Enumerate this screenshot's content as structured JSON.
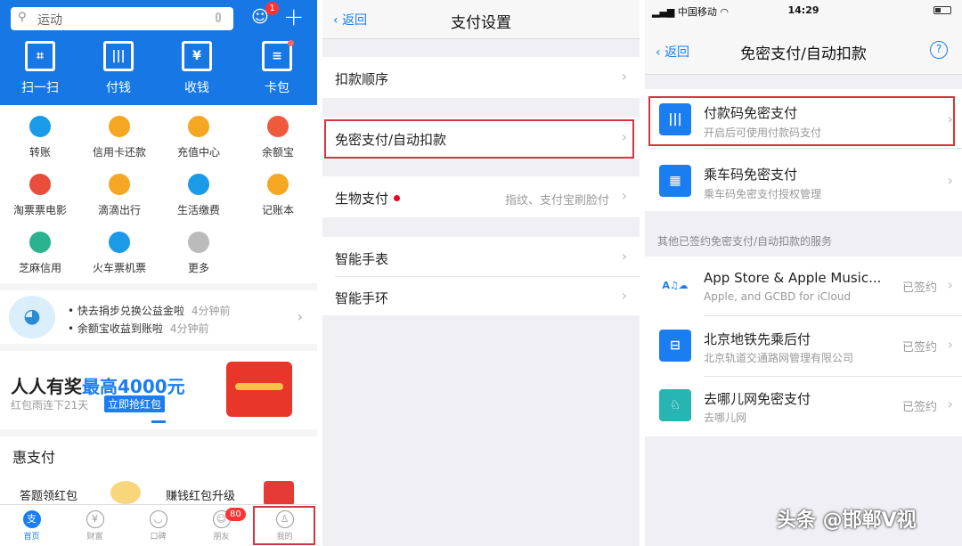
{
  "panel1": {
    "search": {
      "placeholder": "运动"
    },
    "contact_badge": "1",
    "big_actions": [
      {
        "label": "扫一扫",
        "icon": "scan-icon"
      },
      {
        "label": "付钱",
        "icon": "barcode-icon"
      },
      {
        "label": "收钱",
        "icon": "receive-money-icon"
      },
      {
        "label": "卡包",
        "icon": "card-wallet-icon"
      }
    ],
    "grid": [
      {
        "label": "转账",
        "icon": "transfer-icon",
        "color": "#1b9ae8"
      },
      {
        "label": "信用卡还款",
        "icon": "credit-card-icon",
        "color": "#f5a623"
      },
      {
        "label": "充值中心",
        "icon": "phone-icon",
        "color": "#f5a623"
      },
      {
        "label": "余额宝",
        "icon": "money-bag-icon",
        "color": "#f05a3c"
      },
      {
        "label": "淘票票电影",
        "icon": "movie-icon",
        "color": "#e94e3b"
      },
      {
        "label": "滴滴出行",
        "icon": "didi-icon",
        "color": "#f5a623"
      },
      {
        "label": "生活缴费",
        "icon": "bolt-icon",
        "color": "#1b9ae8"
      },
      {
        "label": "记账本",
        "icon": "ledger-icon",
        "color": "#f5a623"
      },
      {
        "label": "芝麻信用",
        "icon": "sesame-icon",
        "color": "#2bb28f"
      },
      {
        "label": "火车票机票",
        "icon": "train-icon",
        "color": "#1b9ae8"
      },
      {
        "label": "更多",
        "icon": "more-grid-icon",
        "color": "#bbbbbb"
      }
    ],
    "news": [
      {
        "text": "快去捐步兑换公益金啦",
        "time": "4分钟前"
      },
      {
        "text": "余额宝收益到账啦",
        "time": "4分钟前"
      }
    ],
    "promo": {
      "title_a": "人人有奖",
      "title_b": "最高4000元",
      "sub": "红包雨连下21天",
      "button": "立即抢红包"
    },
    "hui": {
      "heading": "惠支付",
      "item_a": "答题领红包",
      "item_b": "赚钱红包升级"
    },
    "tabs": [
      {
        "label": "首页",
        "glyph": "支"
      },
      {
        "label": "财富",
        "glyph": "¥"
      },
      {
        "label": "口碑",
        "glyph": "◡"
      },
      {
        "label": "朋友",
        "glyph": "☺"
      },
      {
        "label": "我的",
        "glyph": "♙"
      }
    ],
    "friends_badge": "80"
  },
  "panel2": {
    "back": "返回",
    "title": "支付设置",
    "rows": [
      {
        "label": "扣款顺序",
        "value": ""
      },
      {
        "label": "免密支付/自动扣款",
        "value": ""
      },
      {
        "label": "生物支付",
        "value": "指纹、支付宝刷脸付"
      },
      {
        "label": "智能手表",
        "value": ""
      },
      {
        "label": "智能手环",
        "value": ""
      }
    ]
  },
  "panel3": {
    "carrier": "中国移动",
    "time": "14:29",
    "back": "返回",
    "title": "免密支付/自动扣款",
    "help": "?",
    "top_items": [
      {
        "title": "付款码免密支付",
        "sub": "开启后可使用付款码支付",
        "icon": "barcode-icon",
        "color": "#1b7ef0"
      },
      {
        "title": "乘车码免密支付",
        "sub": "乘车码免密支付授权管理",
        "icon": "qr-code-icon",
        "color": "#1b7ef0"
      }
    ],
    "section": "其他已签约免密支付/自动扣款的服务",
    "services": [
      {
        "title": "App Store & Apple Music...",
        "sub": "Apple, and GCBD for iCloud",
        "status": "已签约",
        "icon": "app-store-icon",
        "color": "#ffffff"
      },
      {
        "title": "北京地铁先乘后付",
        "sub": "北京轨道交通路网管理有限公司",
        "status": "已签约",
        "icon": "subway-icon",
        "color": "#1b7ef0"
      },
      {
        "title": "去哪儿网免密支付",
        "sub": "去哪儿网",
        "status": "已签约",
        "icon": "camel-icon",
        "color": "#26b5b0"
      }
    ]
  },
  "watermark": "头条 @邯郸V视"
}
